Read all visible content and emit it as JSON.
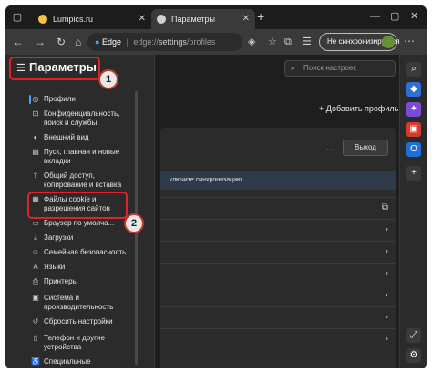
{
  "tabs": [
    {
      "title": "Lumpics.ru",
      "color": "#f4c542"
    },
    {
      "title": "Параметры",
      "color": "#d0d0d0"
    }
  ],
  "address": {
    "browser": "Edge",
    "separator": "|",
    "url_prefix": "edge://",
    "url_path": "settings",
    "url_tail": "/profiles"
  },
  "sync_button": "Не синхронизируется",
  "sidebar": {
    "title": "Параметры",
    "items": [
      {
        "icon": "profile-icon",
        "label": "Профили"
      },
      {
        "icon": "lock-icon",
        "label": "Конфиденциальность, поиск и службы"
      },
      {
        "icon": "appearance-icon",
        "label": "Внешний вид"
      },
      {
        "icon": "start-icon",
        "label": "Пуск, главная и новые вкладки"
      },
      {
        "icon": "share-icon",
        "label": "Общий доступ, копирование и вставка"
      },
      {
        "icon": "cookie-icon",
        "label": "Файлы cookie и разрешения сайтов"
      },
      {
        "icon": "browser-icon",
        "label": "Браузер по умолча..."
      },
      {
        "icon": "download-icon",
        "label": "Загрузки"
      },
      {
        "icon": "family-icon",
        "label": "Семейная безопасность"
      },
      {
        "icon": "language-icon",
        "label": "Языки"
      },
      {
        "icon": "printer-icon",
        "label": "Принтеры"
      },
      {
        "icon": "system-icon",
        "label": "Система и производительность"
      },
      {
        "icon": "reset-icon",
        "label": "Сбросить настройки"
      },
      {
        "icon": "phone-icon",
        "label": "Телефон и другие устройства"
      },
      {
        "icon": "accessibility-icon",
        "label": "Специальные"
      }
    ]
  },
  "main": {
    "search_placeholder": "Поиск настроек",
    "add_profile": "Добавить профиль",
    "logout": "Выход",
    "dots": "...",
    "sync_banner": "...ключите синхронизацию."
  },
  "annotations": [
    "1",
    "2"
  ],
  "colors": {
    "accent": "#4aa3ff",
    "highlight": "#e0232b"
  }
}
